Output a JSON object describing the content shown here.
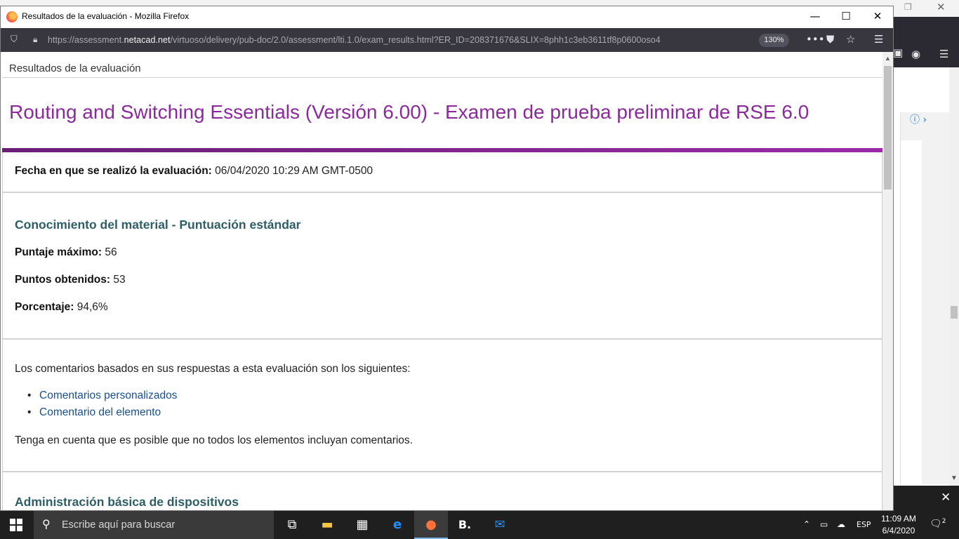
{
  "firefox": {
    "window_title": "Resultados de la evaluación - Mozilla Firefox",
    "url_prefix": "https://assessment.",
    "url_domain": "netacad.net",
    "url_path": "/virtuoso/delivery/pub-doc/2.0/assessment/lti.1.0/exam_results.html?ER_ID=208371676&SLIX=8phh1c3eb3611tf8p0600oso4",
    "zoom": "130%"
  },
  "page": {
    "breadcrumb": "Resultados de la evaluación",
    "title": "Routing and Switching Essentials (Versión 6.00) - Examen de prueba preliminar de RSE 6.0",
    "date_label": "Fecha en que se realizó la evaluación:",
    "date_value": "06/04/2020 10:29 AM GMT-0500",
    "knowledge": {
      "heading": "Conocimiento del material - Puntuación estándar",
      "max_label": "Puntaje máximo:",
      "max_value": "56",
      "earned_label": "Puntos obtenidos:",
      "earned_value": "53",
      "percent_label": "Porcentaje:",
      "percent_value": "94,6%"
    },
    "feedback": {
      "intro": "Los comentarios basados en sus respuestas a esta evaluación son los siguientes:",
      "links": [
        "Comentarios personalizados",
        "Comentario del elemento"
      ],
      "note": "Tenga en cuenta que es posible que no todos los elementos incluyan comentarios."
    },
    "next_section_heading": "Administración básica de dispositivos"
  },
  "taskbar": {
    "search_placeholder": "Escribe aquí para buscar",
    "language": "ESP",
    "time": "11:09 AM",
    "date": "6/4/2020",
    "notification_count": "2"
  },
  "icons": {
    "accent_purple": "#8a2a9b",
    "heading_teal": "#2e5f66",
    "link_blue": "#1a4f8a"
  }
}
